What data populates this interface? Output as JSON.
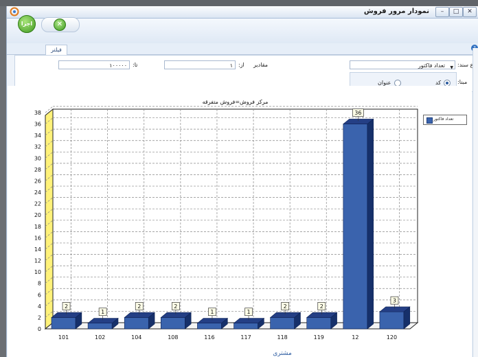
{
  "window": {
    "title": "نمودار مرور فروش",
    "buttons": {
      "minimize": "–",
      "maximize": "□",
      "close": "✕"
    }
  },
  "toolbar": {
    "run_label": "اجرا"
  },
  "tabs": [
    {
      "label": "فیلتر"
    }
  ],
  "filter": {
    "doc_type_label": "نوع سند:",
    "doc_type_value": "تعداد فاکتور",
    "values_label": "مقادیر",
    "from_label": "از:",
    "from_value": "۱",
    "to_label": "تا:",
    "to_value": "۱۰۰۰۰۰",
    "basis_label": "مبنا:",
    "basis_options": [
      {
        "label": "کد",
        "selected": true
      },
      {
        "label": "عنوان",
        "selected": false
      }
    ]
  },
  "chart_data": {
    "type": "bar",
    "title": "مرکز فروش=فروش متفرقه",
    "xlabel": "مشتری",
    "ylabel": "",
    "categories": [
      "101",
      "102",
      "104",
      "108",
      "116",
      "117",
      "118",
      "119",
      "12",
      "120"
    ],
    "series": [
      {
        "name": "تعداد فاکتور",
        "values": [
          2,
          1,
          2,
          2,
          1,
          1,
          2,
          2,
          36,
          3
        ]
      }
    ],
    "ylim": [
      0,
      38
    ],
    "yticks": [
      0,
      2,
      4,
      6,
      8,
      10,
      12,
      14,
      16,
      18,
      20,
      22,
      24,
      26,
      28,
      30,
      32,
      34,
      36,
      38
    ],
    "grid": true,
    "legend_position": "top-right",
    "colors": {
      "bar_front": "#3a63ad",
      "bar_side": "#16306a",
      "bar_top": "#243f85",
      "wall": "#fff27a"
    }
  }
}
